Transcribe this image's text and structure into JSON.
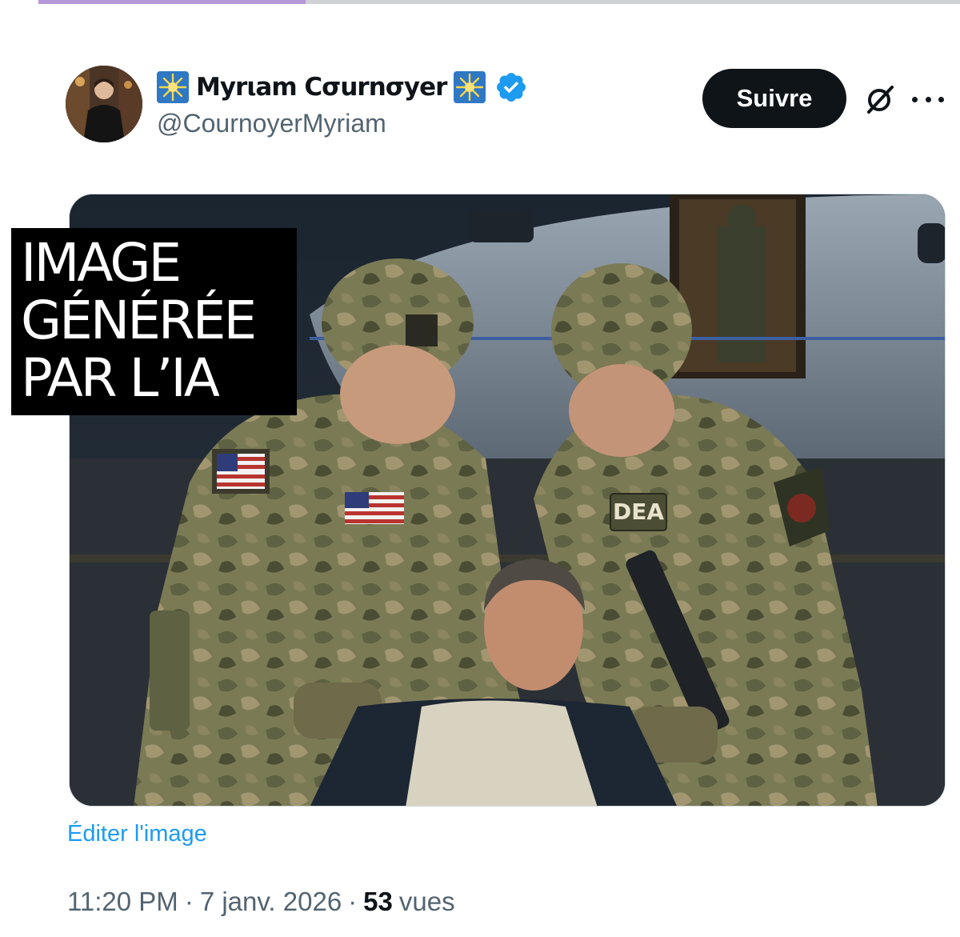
{
  "progress": {
    "fraction": 0.29,
    "fill_color": "#b596d8",
    "track_color": "#cfd2d5"
  },
  "author": {
    "display_name": "Myriam Cournoyer",
    "display_name_styled": "Myrιam Cσurnσyer",
    "handle": "@CournoyerMyriam",
    "verified": true,
    "verified_color": "#1d9bf0",
    "name_decoration_icon": "sparkle-emoji-icon"
  },
  "header_actions": {
    "follow_label": "Suivre",
    "grok_icon": "grok-icon",
    "more_icon": "more-options-icon"
  },
  "media": {
    "overlay_label_lines": [
      "IMAGE",
      "GÉNÉRÉE",
      "PAR L’IA"
    ],
    "patch_text": "DEA"
  },
  "edit_image_label": "Éditer l'image",
  "meta": {
    "time": "11:20 PM",
    "separator": "·",
    "date": "7 janv. 2026",
    "views_count": "53",
    "views_label": "vues"
  },
  "colors": {
    "text_primary": "#0f1419",
    "text_secondary": "#536471",
    "link": "#1d9bf0",
    "button_bg": "#0f1419"
  }
}
